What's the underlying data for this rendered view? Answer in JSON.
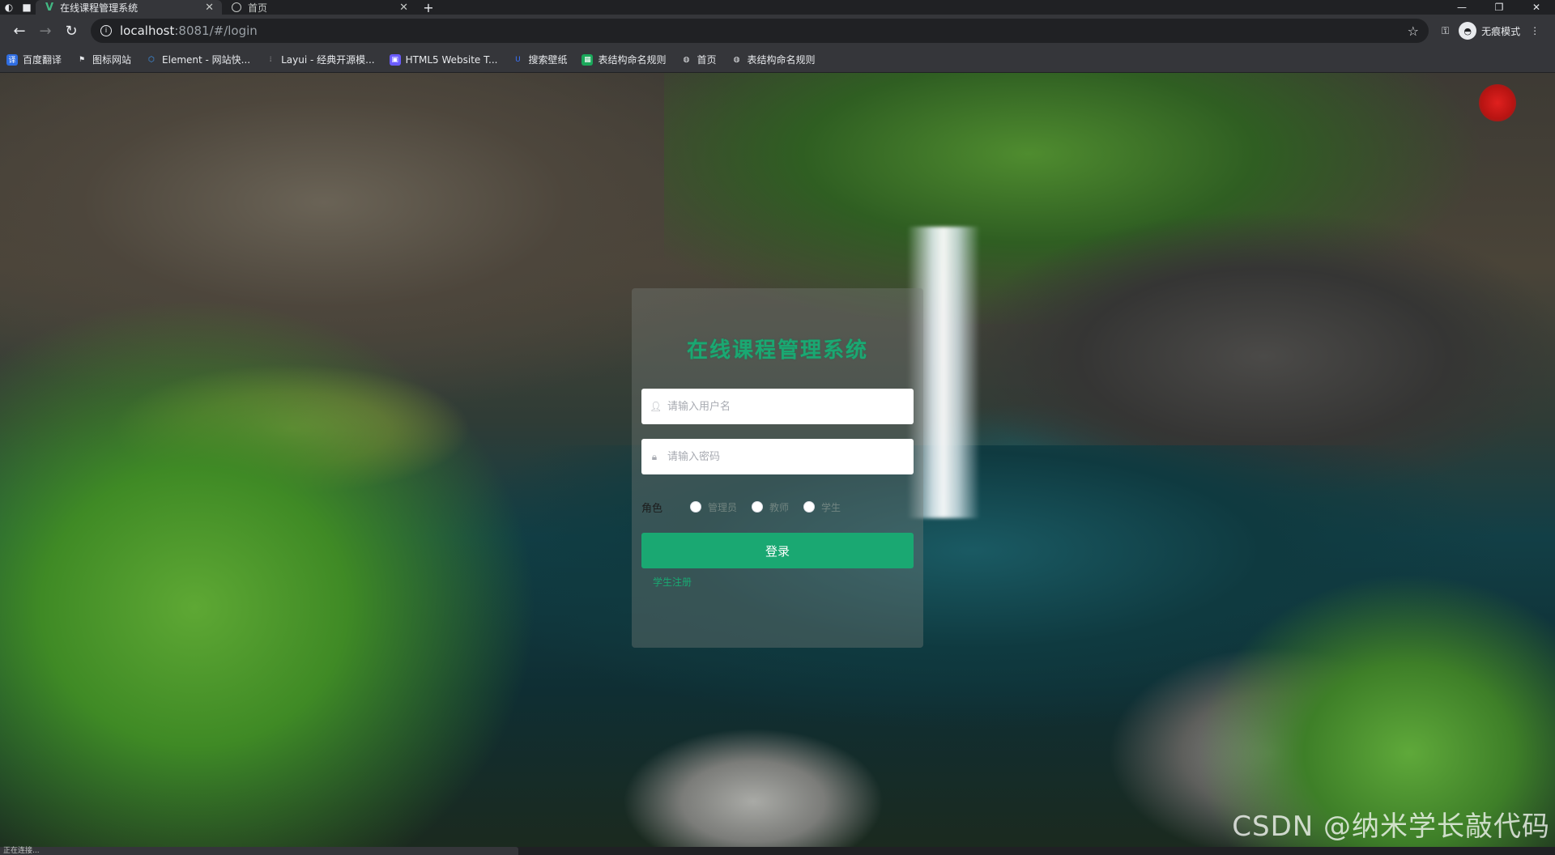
{
  "browser": {
    "tabs": [
      {
        "title": "在线课程管理系统",
        "active": true,
        "favicon": "vue-icon"
      },
      {
        "title": "首页",
        "active": false,
        "favicon": "globe-icon"
      }
    ],
    "url_host": "localhost",
    "url_rest": ":8081/#/login",
    "incognito_label": "无痕模式",
    "bookmarks": [
      {
        "label": "百度翻译",
        "icon": "baidu-translate-icon",
        "color": "#2f6de1"
      },
      {
        "label": "图标网站",
        "icon": "flag-icon",
        "color": "#e8eaed"
      },
      {
        "label": "Element - 网站快...",
        "icon": "element-icon",
        "color": "#409eff"
      },
      {
        "label": "Layui - 经典开源模...",
        "icon": "layui-icon",
        "color": "#e8eaed"
      },
      {
        "label": "HTML5 Website T...",
        "icon": "html5-icon",
        "color": "#6b5cff"
      },
      {
        "label": "搜索壁纸",
        "icon": "wallpaper-icon",
        "color": "#3a74ff"
      },
      {
        "label": "表结构命名规则",
        "icon": "sheet-icon",
        "color": "#1aa85a"
      },
      {
        "label": "首页",
        "icon": "globe-icon",
        "color": "#e8eaed"
      },
      {
        "label": "表结构命名规则",
        "icon": "globe-icon",
        "color": "#e8eaed"
      }
    ]
  },
  "login": {
    "title": "在线课程管理系统",
    "username_placeholder": "请输入用户名",
    "password_placeholder": "请输入密码",
    "role_label": "角色",
    "roles": [
      "管理员",
      "教师",
      "学生"
    ],
    "submit_label": "登录",
    "register_label": "学生注册",
    "accent_color": "#1aa872"
  },
  "watermark": "CSDN @纳米学长敲代码",
  "status_text": "正在连接..."
}
